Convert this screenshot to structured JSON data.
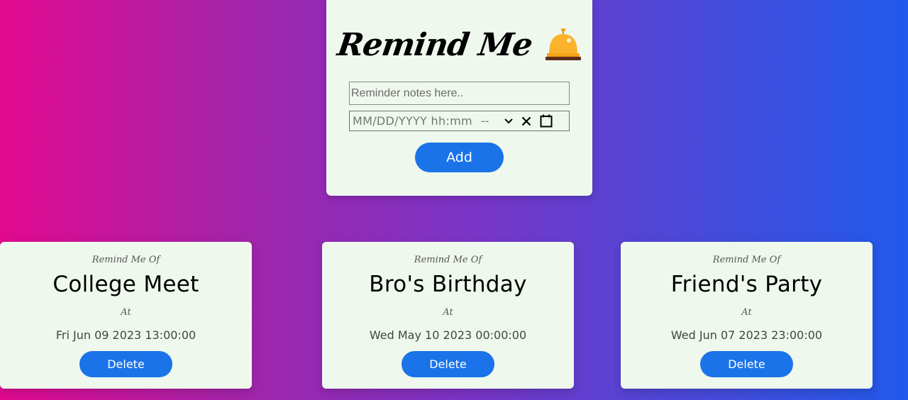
{
  "form": {
    "title": "Remind Me",
    "bell_icon": "service-bell-icon",
    "notes_placeholder": "Reminder notes here..",
    "datetime_placeholder": "MM/DD/YYYY hh:mm",
    "datetime_ampm": "--",
    "add_label": "Add"
  },
  "colors": {
    "card_background": "#eff8ed",
    "button": "#1a73e8",
    "gradient_left": "#e2098f",
    "gradient_right": "#2159ea"
  },
  "reminders": [
    {
      "caption": "Remind Me Of",
      "title": "Bro's Birthday",
      "at_label": "At",
      "datetime": "Wed May 10 2023 00:00:00",
      "delete_label": "Delete"
    },
    {
      "caption": "Remind Me Of",
      "title": "Friend's Party",
      "at_label": "At",
      "datetime": "Wed Jun 07 2023 23:00:00",
      "delete_label": "Delete"
    },
    {
      "caption": "Remind Me Of",
      "title": "College Meet",
      "at_label": "At",
      "datetime": "Fri Jun 09 2023 13:00:00",
      "delete_label": "Delete"
    }
  ]
}
